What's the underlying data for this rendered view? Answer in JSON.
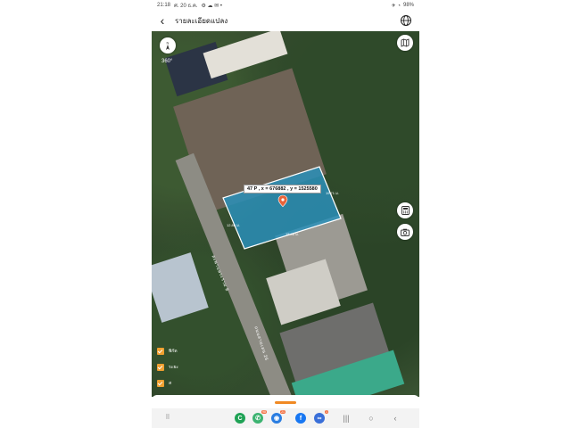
{
  "status": {
    "time": "21:18",
    "date": "ศ. 20 ธ.ค.",
    "battery": "98%"
  },
  "header": {
    "title": "รายละเอียดแปลง"
  },
  "map": {
    "compass_label": "360°",
    "coordinate_label": "47 P , x = 676882 , y = 1525580",
    "dim_top": "19.71 ม.",
    "dim_left": "12.86 ม.",
    "dim_bottom": "15.46 ม.",
    "road_label_1": "สะพานพระราม 8",
    "road_label_2": "ถนนสามเสน 26",
    "legend": [
      {
        "label": "พิกัด"
      },
      {
        "label": "ระยะ"
      },
      {
        "label": "ส"
      }
    ]
  },
  "navbar": {
    "badges": [
      "98",
      "21",
      "1"
    ]
  },
  "colors": {
    "accent": "#f08a24",
    "plot_fill": "#2a8fb8",
    "checkbox": "#f0a030"
  }
}
